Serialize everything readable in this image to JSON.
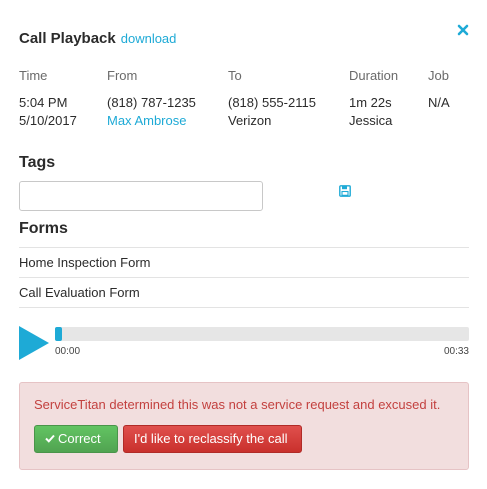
{
  "header": {
    "title": "Call Playback",
    "download_label": "download"
  },
  "call_info": {
    "columns": [
      {
        "label": "Time",
        "line1": "5:04 PM",
        "line2": "5/10/2017"
      },
      {
        "label": "From",
        "line1": "(818) 787-1235",
        "line2": "Max Ambrose"
      },
      {
        "label": "To",
        "line1": "(818) 555-2115",
        "line2": "Verizon"
      },
      {
        "label": "Duration",
        "line1": "1m 22s",
        "line2": "Jessica"
      },
      {
        "label": "Job",
        "line1": "N/A",
        "line2": ""
      }
    ]
  },
  "tags": {
    "title": "Tags",
    "input_value": "",
    "save_icon": "floppy-disk-icon"
  },
  "forms": {
    "title": "Forms",
    "items": [
      "Home Inspection Form",
      "Call Evaluation Form"
    ]
  },
  "player": {
    "current_time": "00:00",
    "total_time": "00:33",
    "progress_fraction": 0.0
  },
  "alert": {
    "message": "ServiceTitan determined this was not a service request and excused it.",
    "correct_label": "Correct",
    "reclassify_label": "I'd like to reclassify the call"
  },
  "colors": {
    "accent": "#1eaad6",
    "alert_bg": "#f2dede",
    "alert_text": "#c3413f",
    "success": "#5cb85c",
    "danger": "#d9534f"
  }
}
